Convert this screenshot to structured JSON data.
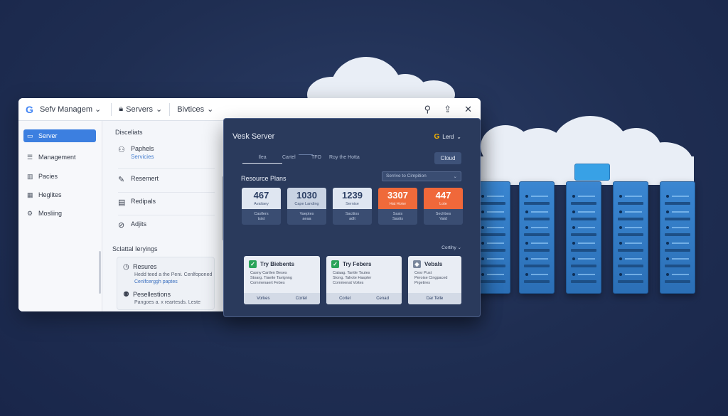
{
  "window": {
    "app_title": "Sefv Managem",
    "menu": [
      {
        "label": "Servers"
      },
      {
        "label": "Bivtices"
      }
    ]
  },
  "sidebar": {
    "items": [
      {
        "label": "Server",
        "icon": "server-icon",
        "active": true
      },
      {
        "label": "Management",
        "icon": "list-icon"
      },
      {
        "label": "Pacies",
        "icon": "chart-icon"
      },
      {
        "label": "Heglites",
        "icon": "grid-icon"
      },
      {
        "label": "Mosliing",
        "icon": "gear-icon"
      }
    ]
  },
  "middle": {
    "heading": "Disceliats",
    "items": [
      {
        "label": "Paphels",
        "sub": "Servicies",
        "icon": "user-icon"
      },
      {
        "label": "Resemert",
        "icon": "edit-icon"
      },
      {
        "label": "Redipals",
        "icon": "document-icon"
      },
      {
        "label": "Adjits",
        "icon": "adjust-icon"
      }
    ],
    "settings_heading": "Sclattal Ieryings",
    "settings": [
      {
        "title": "Resures",
        "desc": "Hedd teed a the Peni. Cenlfoponed",
        "link": "Cenlfcerggh paptes"
      },
      {
        "title": "Pesellestions",
        "desc": "Pangoes a. x reartesds. Leste"
      }
    ]
  },
  "panel": {
    "title": "Vesk Server",
    "user": "Lerd",
    "tabs": [
      "Ilea",
      "Cartel",
      "TFO",
      "Roy the Hotta"
    ],
    "cloud_button": "Cloud",
    "resource_title": "Resource Plans",
    "select_value": "Serrive to Cimpition",
    "stats": [
      {
        "value": "467",
        "label": "Availaey",
        "foot1": "Castlers",
        "foot2": "tsist"
      },
      {
        "value": "1030",
        "label": "Cape Landing",
        "foot1": "Vaeptes",
        "foot2": "aeaa"
      },
      {
        "value": "1239",
        "label": "Sernise",
        "foot1": "Sacitios",
        "foot2": "adlt"
      },
      {
        "value": "3307",
        "label": "Hat Hoter",
        "foot1": "Sasis",
        "foot2": "Sastis"
      },
      {
        "value": "447",
        "label": "Lote",
        "foot1": "Sechbes",
        "foot2": "Vaid"
      }
    ],
    "sort_label": "Cortihy",
    "plans": [
      {
        "title": "Try Biebents",
        "desc": [
          "Casny Cartlen Beses",
          "Stoarg. Tiaeite Tavignng",
          "Commenaert Febes"
        ],
        "actions": [
          "Vorkes",
          "Cortel"
        ]
      },
      {
        "title": "Try Febers",
        "desc": [
          "Calaag. Tantle Tsutes",
          "Stong. Tahote Haspler",
          "Commenat Voites"
        ],
        "actions": [
          "Cortel",
          "Cenad"
        ]
      },
      {
        "title": "Vebals",
        "desc": [
          "Cesr Pust",
          "Peroise Cingpaced",
          "Prgetires"
        ],
        "actions": [
          "Dar Telle"
        ]
      }
    ]
  },
  "colors": {
    "background": "#1f2e52",
    "accent": "#3c7fe0",
    "orange": "#ef6a3a",
    "server": "#2b6fb6"
  }
}
